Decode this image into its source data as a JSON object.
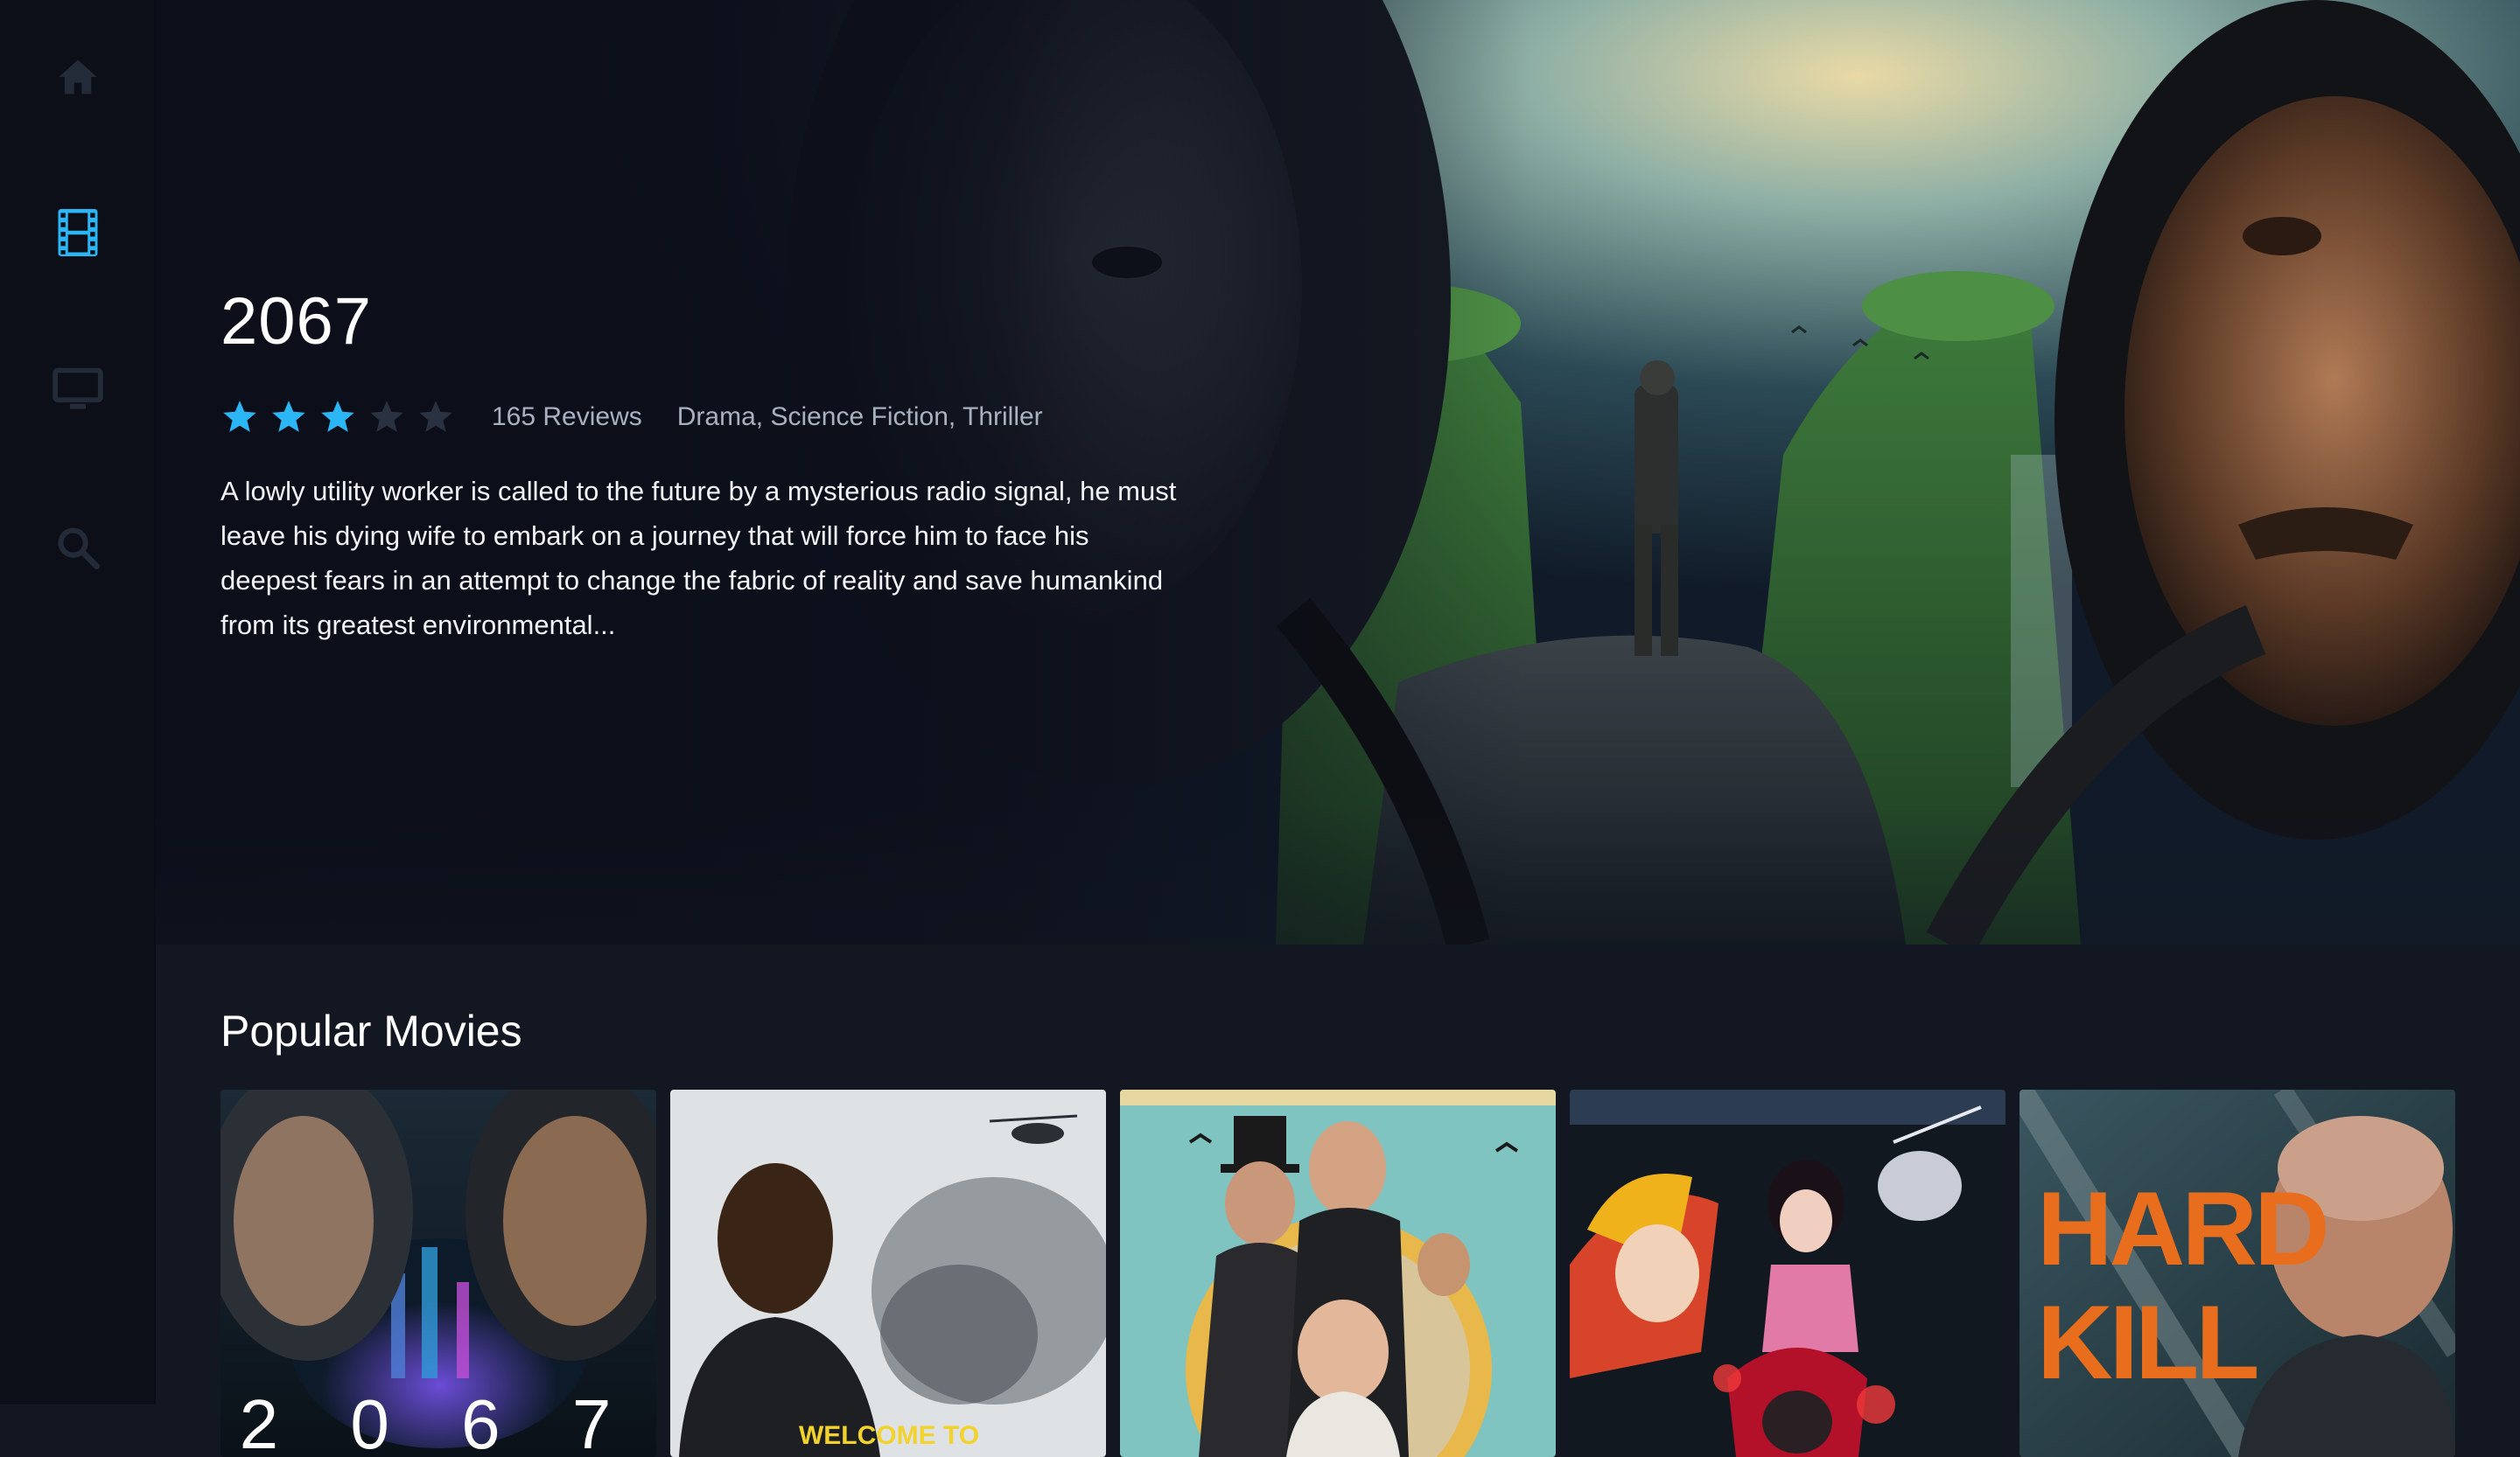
{
  "sidebar": {
    "items": [
      {
        "name": "home",
        "icon": "home-icon",
        "active": false
      },
      {
        "name": "movies",
        "icon": "film-icon",
        "active": true
      },
      {
        "name": "tv",
        "icon": "tv-icon",
        "active": false
      },
      {
        "name": "search",
        "icon": "search-icon",
        "active": false
      }
    ],
    "accent": "#2bb6f5",
    "inactive": "#232a38"
  },
  "hero": {
    "title": "2067",
    "rating": {
      "filled": 3,
      "total": 5
    },
    "reviews": "165 Reviews",
    "genres": "Drama, Science Fiction, Thriller",
    "overview": "A lowly utility worker is called to the future by a mysterious radio signal, he must leave his dying wife to embark on a journey that will force him to face his deepest fears in an attempt to change the fabric of reality and save humankind from its greatest environmental..."
  },
  "popular": {
    "title": "Popular Movies",
    "posters": [
      {
        "name": "2067",
        "label": "2 0 6 7"
      },
      {
        "name": "welcome-to-sudden-death",
        "label": "WELCOME TO"
      },
      {
        "name": "enola-holmes",
        "label": ""
      },
      {
        "name": "demon-slayer",
        "label": ""
      },
      {
        "name": "hard-kill",
        "label": "HARD KILL"
      }
    ]
  },
  "colors": {
    "star_filled": "#2bb6f5",
    "star_empty": "#2a3140",
    "background": "#121722",
    "sidebar": "#0c0f18"
  }
}
